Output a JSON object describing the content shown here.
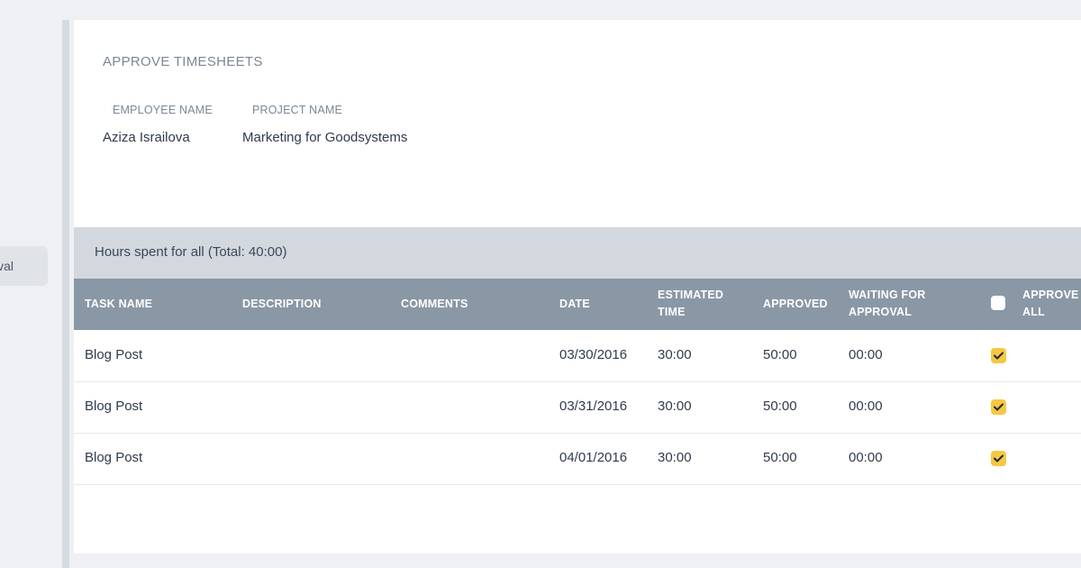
{
  "sidebar": {
    "active_item_label": "val"
  },
  "panel": {
    "title": "APPROVE TIMESHEETS",
    "employee_label": "EMPLOYEE NAME",
    "employee_value": "Aziza Israilova",
    "project_label": "PROJECT NAME",
    "project_value": "Marketing for Goodsystems"
  },
  "summary": {
    "text": "Hours spent for all (Total: 40:00)"
  },
  "table": {
    "headers": {
      "task_name": "TASK NAME",
      "description": "DESCRIPTION",
      "comments": "COMMENTS",
      "date": "DATE",
      "estimated_1": "ESTIMATED",
      "estimated_2": "TIME",
      "approved": "APPROVED",
      "waiting_1": "WAITING FOR",
      "waiting_2": "APPROVAL",
      "approve_all_1": "APPROVE",
      "approve_all_2": "ALL"
    },
    "approve_all_checked": false,
    "rows": [
      {
        "task": "Blog Post",
        "description": "",
        "comments": "",
        "date": "03/30/2016",
        "estimated": "30:00",
        "approved": "50:00",
        "waiting": "00:00",
        "checked": true
      },
      {
        "task": "Blog Post",
        "description": "",
        "comments": "",
        "date": "03/31/2016",
        "estimated": "30:00",
        "approved": "50:00",
        "waiting": "00:00",
        "checked": true
      },
      {
        "task": "Blog Post",
        "description": "",
        "comments": "",
        "date": "04/01/2016",
        "estimated": "30:00",
        "approved": "50:00",
        "waiting": "00:00",
        "checked": true
      }
    ]
  },
  "colors": {
    "background": "#eef0f3",
    "header_bar": "#8a97a5",
    "summary_bar": "#d3d8de",
    "checkbox_checked": "#f5c842"
  }
}
